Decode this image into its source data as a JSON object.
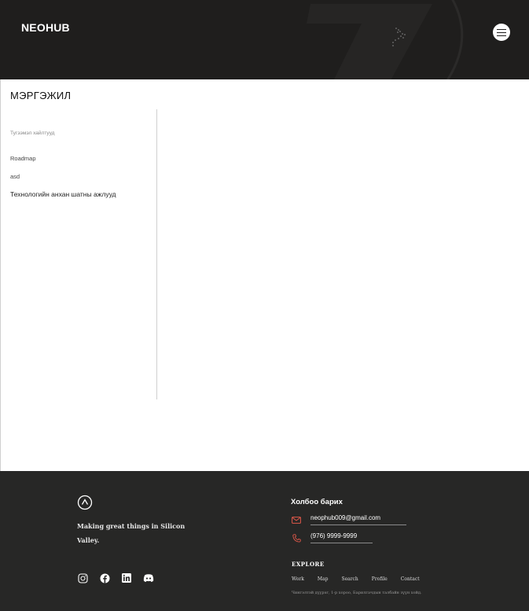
{
  "header": {
    "logo": "NEOHUB"
  },
  "main": {
    "title": "МЭРГЭЖИЛ",
    "sidebar": {
      "heading": "Тугээмэл хайлтууд",
      "items": [
        {
          "label": "Roadmap"
        },
        {
          "label": "asd"
        },
        {
          "label": "Технологийн анхан шатны ажлууд"
        }
      ]
    }
  },
  "footer": {
    "tagline": "Making great things in Silicon Valley.",
    "socials": [
      "instagram-icon",
      "facebook-icon",
      "linkedin-icon",
      "discord-icon"
    ],
    "contact": {
      "title": "Холбоо барих",
      "email": "neophub009@gmail.com",
      "phone": "(976) 9999-9999"
    },
    "explore": {
      "title": "EXPLORE",
      "links": [
        "Work",
        "Map",
        "Search",
        "Profile",
        "Contact"
      ]
    },
    "address": "Чингэлтэй дүүрэг, 1-р хороо, Барилгачдын талбайн зүүн хойд."
  },
  "colors": {
    "header_bg": "#1f1e1d",
    "footer_bg": "#272726",
    "accent_icon": "#e0584a"
  }
}
